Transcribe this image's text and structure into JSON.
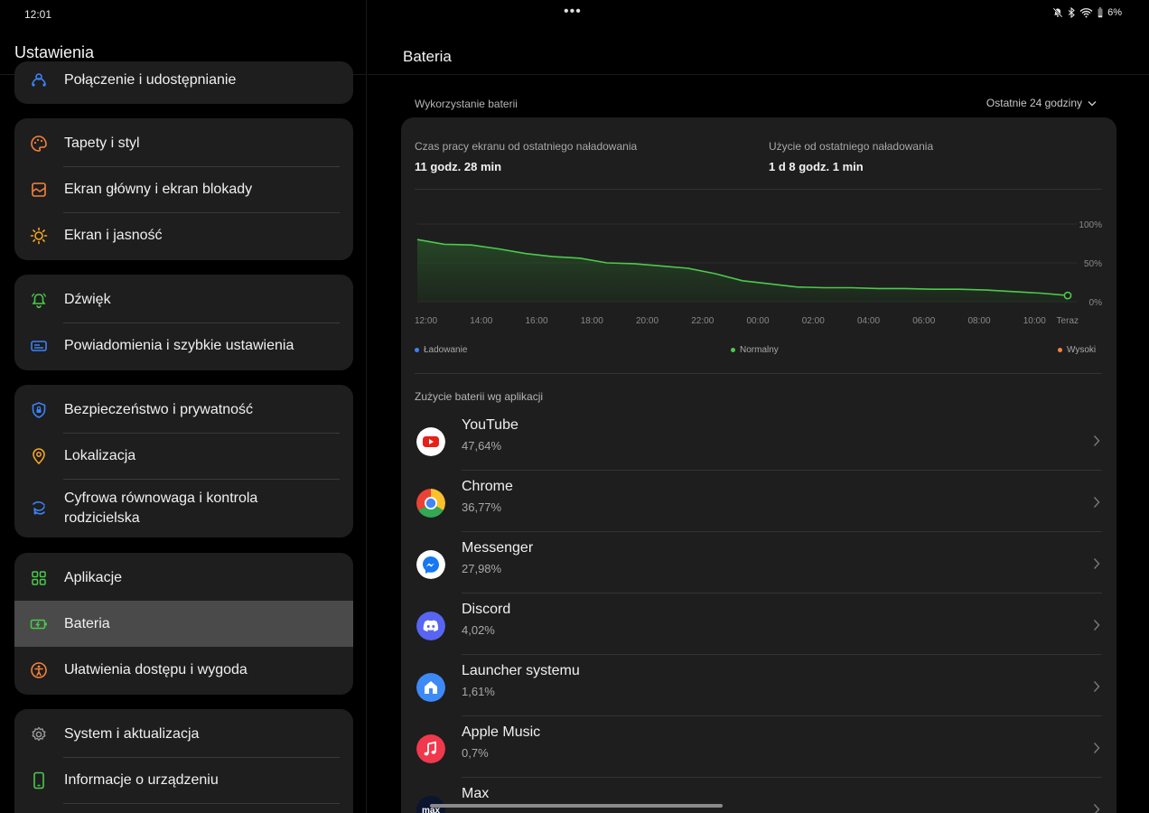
{
  "status": {
    "time": "12:01",
    "dots": "•••",
    "battery_pct": "6%",
    "icons": [
      "bell-off-icon",
      "bluetooth-icon",
      "wifi-icon",
      "battery-icon"
    ]
  },
  "left": {
    "title": "Ustawienia",
    "groups": [
      {
        "items": [
          {
            "label": "Połączenie i udostępnianie",
            "icon": "share-connection-icon",
            "color": "#3b82f6"
          }
        ]
      },
      {
        "items": [
          {
            "label": "Tapety i styl",
            "icon": "palette-icon",
            "color": "#f5823c"
          },
          {
            "label": "Ekran główny i ekran blokady",
            "icon": "home-screen-icon",
            "color": "#f5823c"
          },
          {
            "label": "Ekran i jasność",
            "icon": "sun-icon",
            "color": "#f5a623"
          }
        ]
      },
      {
        "items": [
          {
            "label": "Dźwięk",
            "icon": "alarm-bell-icon",
            "color": "#4cc94c"
          },
          {
            "label": "Powiadomienia i szybkie ustawienia",
            "icon": "notification-panel-icon",
            "color": "#3b82f6"
          }
        ]
      },
      {
        "items": [
          {
            "label": "Bezpieczeństwo i prywatność",
            "icon": "shield-icon",
            "color": "#3b82f6"
          },
          {
            "label": "Lokalizacja",
            "icon": "location-pin-icon",
            "color": "#f5a623"
          },
          {
            "label": "Cyfrowa równowaga i kontrola rodzicielska",
            "icon": "digital-wellbeing-icon",
            "color": "#3b82f6"
          }
        ]
      },
      {
        "items": [
          {
            "label": "Aplikacje",
            "icon": "apps-grid-icon",
            "color": "#4cc94c"
          },
          {
            "label": "Bateria",
            "icon": "battery-charging-icon",
            "color": "#4cc94c",
            "active": true
          },
          {
            "label": "Ułatwienia dostępu i wygoda",
            "icon": "accessibility-icon",
            "color": "#f5823c"
          }
        ]
      },
      {
        "items": [
          {
            "label": "System i aktualizacja",
            "icon": "gear-icon",
            "color": "#9a9a9a"
          },
          {
            "label": "Informacje o urządzeniu",
            "icon": "phone-icon",
            "color": "#4cc94c"
          }
        ]
      }
    ]
  },
  "right": {
    "title": "Bateria",
    "usage_label": "Wykorzystanie baterii",
    "range": "Ostatnie 24 godziny",
    "screen_time_label": "Czas pracy ekranu od ostatniego naładowania",
    "screen_time_value": "11 godz. 28 min",
    "usage_since_label": "Użycie od ostatniego naładowania",
    "usage_since_value": "1 d 8 godz. 1 min",
    "legend": [
      {
        "label": "Ładowanie",
        "color": "#3b82f6"
      },
      {
        "label": "Normalny",
        "color": "#4cc94c"
      },
      {
        "label": "Wysoki",
        "color": "#f5823c"
      }
    ],
    "apps_label": "Zużycie baterii wg aplikacji",
    "apps": [
      {
        "name": "YouTube",
        "pct": "47,64%",
        "icon": "youtube-icon"
      },
      {
        "name": "Chrome",
        "pct": "36,77%",
        "icon": "chrome-icon"
      },
      {
        "name": "Messenger",
        "pct": "27,98%",
        "icon": "messenger-icon"
      },
      {
        "name": "Discord",
        "pct": "4,02%",
        "icon": "discord-icon"
      },
      {
        "name": "Launcher systemu",
        "pct": "1,61%",
        "icon": "launcher-icon"
      },
      {
        "name": "Apple Music",
        "pct": "0,7%",
        "icon": "apple-music-icon"
      },
      {
        "name": "Max",
        "pct": "",
        "icon": "max-icon",
        "icon_text": "max"
      }
    ]
  },
  "chart_data": {
    "type": "area",
    "title": "",
    "x": [
      "12:00",
      "13:00",
      "14:00",
      "15:00",
      "16:00",
      "17:00",
      "18:00",
      "19:00",
      "20:00",
      "21:00",
      "22:00",
      "23:00",
      "00:00",
      "01:00",
      "02:00",
      "03:00",
      "04:00",
      "05:00",
      "06:00",
      "07:00",
      "08:00",
      "09:00",
      "10:00",
      "11:00",
      "Teraz"
    ],
    "xticks": [
      "12:00",
      "14:00",
      "16:00",
      "18:00",
      "20:00",
      "22:00",
      "00:00",
      "02:00",
      "04:00",
      "06:00",
      "08:00",
      "10:00",
      "Teraz"
    ],
    "yticks": [
      "100%",
      "50%",
      "0%"
    ],
    "series": [
      {
        "name": "Normalny",
        "color": "#4cc94c",
        "values": [
          80,
          74,
          73,
          68,
          62,
          58,
          56,
          50,
          49,
          46,
          43,
          36,
          27,
          23,
          19,
          18,
          18,
          17,
          17,
          16,
          16,
          15,
          13,
          11,
          8
        ]
      }
    ],
    "ylim": [
      0,
      100
    ],
    "grid": true
  }
}
